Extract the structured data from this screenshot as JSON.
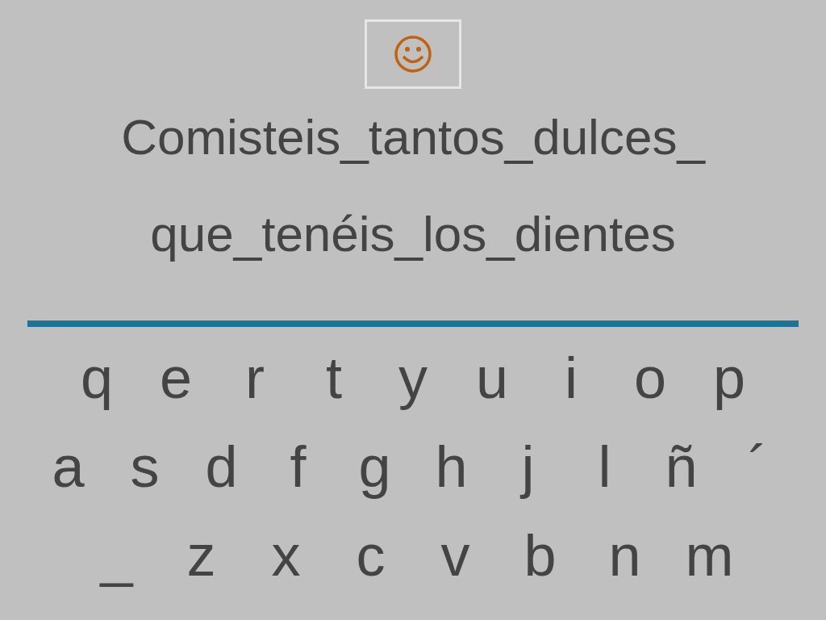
{
  "phrase_lines": [
    "Comisteis_tantos_dulces_",
    "que_tenéis_los_dientes"
  ],
  "keyboard_rows": [
    [
      "q",
      "e",
      "r",
      "t",
      "y",
      "u",
      "i",
      "o",
      "p"
    ],
    [
      "a",
      "s",
      "d",
      "f",
      "g",
      "h",
      "j",
      "l",
      "ñ",
      "´"
    ],
    [
      "_",
      "z",
      "x",
      "c",
      "v",
      "b",
      "n",
      "m"
    ]
  ]
}
